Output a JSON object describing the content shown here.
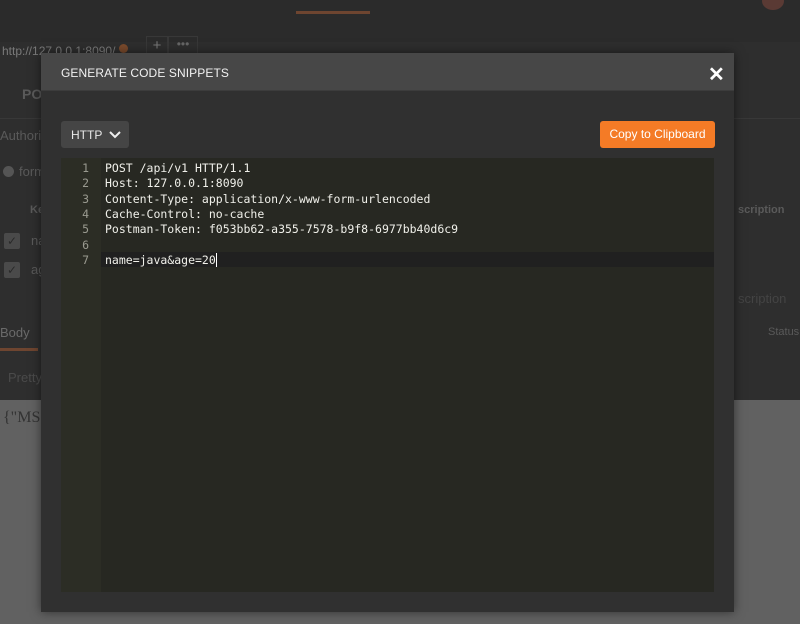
{
  "background": {
    "url_tab": "http://127.0.0.1:8090/",
    "new_tab": "+",
    "more_tabs": "•••",
    "method_partial": "PO",
    "authorization_partial": "Authoriz",
    "form_partial": "form",
    "key_header_partial": "Ke",
    "description_header_partial": "scription",
    "row1_partial": "na",
    "row2_partial": "ag",
    "description_placeholder_partial": "scription",
    "body_tab": "Body",
    "status_partial": "Status",
    "pretty_partial": "Pretty",
    "response_partial": "{\"MSG"
  },
  "modal": {
    "title": "GENERATE CODE SNIPPETS",
    "close_label": "✕",
    "language": "HTTP",
    "copy_button": "Copy to Clipboard",
    "accent_color": "#f47b26",
    "code_lines": [
      "POST /api/v1 HTTP/1.1",
      "Host: 127.0.0.1:8090",
      "Content-Type: application/x-www-form-urlencoded",
      "Cache-Control: no-cache",
      "Postman-Token: f053bb62-a355-7578-b9f8-6977bb40d6c9",
      "",
      "name=java&age=20"
    ],
    "line_numbers": [
      "1",
      "2",
      "3",
      "4",
      "5",
      "6",
      "7"
    ]
  }
}
